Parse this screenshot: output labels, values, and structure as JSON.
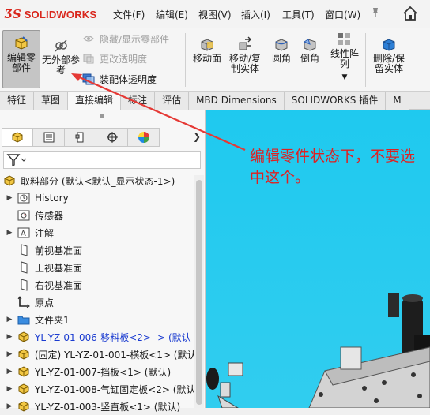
{
  "app": {
    "brand_ds": "ƷS",
    "brand_word": "SOLIDWORKS"
  },
  "menu": [
    {
      "label": "文件(F)"
    },
    {
      "label": "编辑(E)"
    },
    {
      "label": "视图(V)"
    },
    {
      "label": "插入(I)"
    },
    {
      "label": "工具(T)"
    },
    {
      "label": "窗口(W)"
    }
  ],
  "ribbon": {
    "edit_part": "编辑零部件",
    "no_external_refs": "无外部参考",
    "hide_show_parts": "隐藏/显示零部件",
    "change_transparency": "更改透明度",
    "assembly_transparency": "装配体透明度",
    "move_face": "移动面",
    "move_copy_body": "移动/复制实体",
    "fillet": "圆角",
    "chamfer": "倒角",
    "linear_pattern": "线性阵列",
    "delete_keep_body": "删除/保留实体"
  },
  "command_tabs": [
    {
      "label": "特征"
    },
    {
      "label": "草图"
    },
    {
      "label": "直接编辑"
    },
    {
      "label": "标注"
    },
    {
      "label": "评估"
    },
    {
      "label": "MBD Dimensions"
    },
    {
      "label": "SOLIDWORKS 插件"
    },
    {
      "label": "M"
    }
  ],
  "tree": {
    "root": "取料部分  (默认<默认_显示状态-1>)",
    "items": [
      {
        "label": "History"
      },
      {
        "label": "传感器"
      },
      {
        "label": "注解"
      },
      {
        "label": "前视基准面"
      },
      {
        "label": "上视基准面"
      },
      {
        "label": "右视基准面"
      },
      {
        "label": "原点"
      },
      {
        "label": "文件夹1"
      },
      {
        "label": "YL-YZ-01-006-移料板<2> -> (默认"
      },
      {
        "label": "(固定) YL-YZ-01-001-横板<1> (默认"
      },
      {
        "label": "YL-YZ-01-007-挡板<1> (默认)"
      },
      {
        "label": "YL-YZ-01-008-气缸固定板<2> (默认"
      },
      {
        "label": "YL-YZ-01-003-竖直板<1> (默认)"
      }
    ]
  },
  "annotation": {
    "text": "编辑零件状态下，不要选中这个。"
  },
  "colors": {
    "annotation": "#e02020",
    "viewport_bg": "#25c9ef",
    "brand": "#d9261c"
  }
}
